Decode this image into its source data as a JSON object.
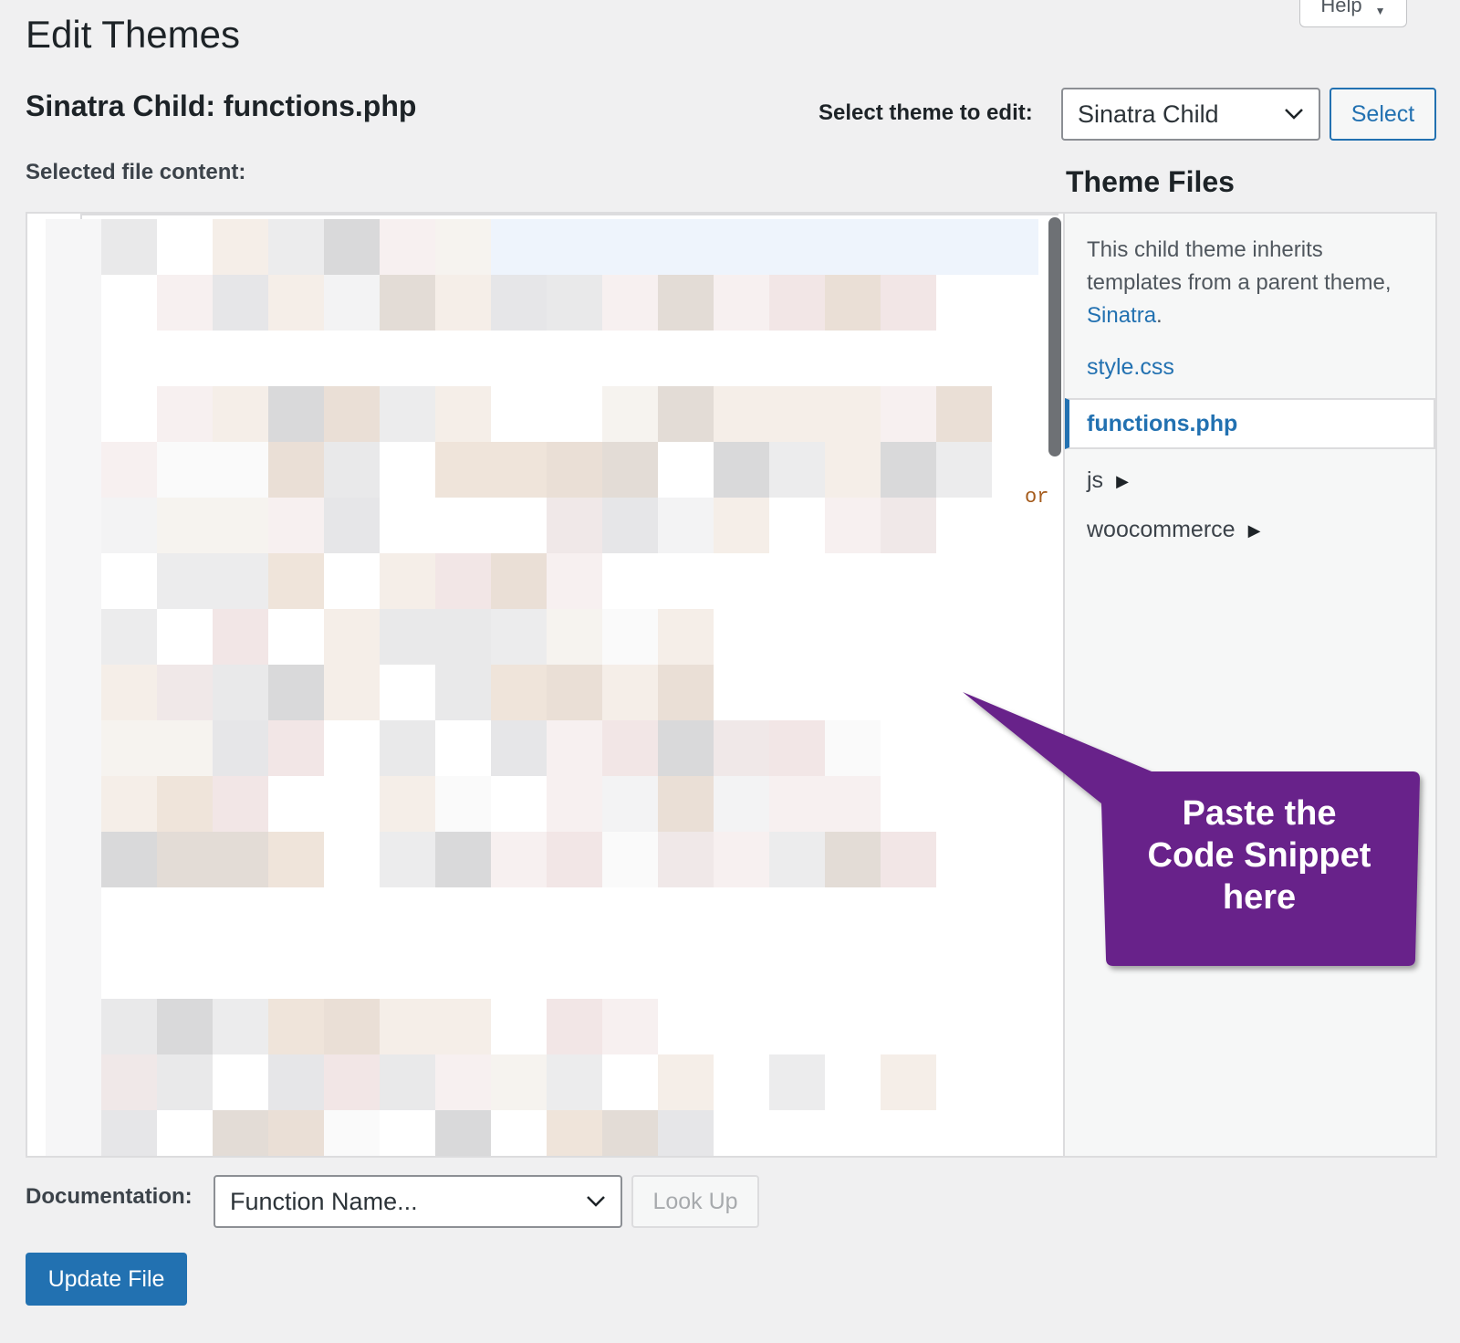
{
  "header": {
    "help_label": "Help",
    "page_title": "Edit Themes",
    "file_heading": "Sinatra Child: functions.php",
    "select_theme_label": "Select theme to edit:",
    "selected_theme": "Sinatra Child",
    "select_button": "Select"
  },
  "editor": {
    "label": "Selected file content:",
    "visible_fragment": "or"
  },
  "sidebar": {
    "heading": "Theme Files",
    "note_prefix": "This child theme inherits templates from a parent theme, ",
    "parent_theme_link": "Sinatra",
    "note_suffix": ".",
    "files": [
      {
        "label": "style.css",
        "active": false
      },
      {
        "label": "functions.php",
        "active": true
      }
    ],
    "folders": [
      {
        "label": "js"
      },
      {
        "label": "woocommerce"
      }
    ]
  },
  "callout": {
    "text_line1": "Paste the",
    "text_line2": "Code Snippet",
    "text_line3": "here",
    "color": "#67208a"
  },
  "footer": {
    "documentation_label": "Documentation:",
    "function_placeholder": "Function Name...",
    "lookup_button": "Look Up",
    "update_button": "Update File"
  },
  "colors": {
    "accent": "#2271b1",
    "background": "#f0f0f1"
  }
}
